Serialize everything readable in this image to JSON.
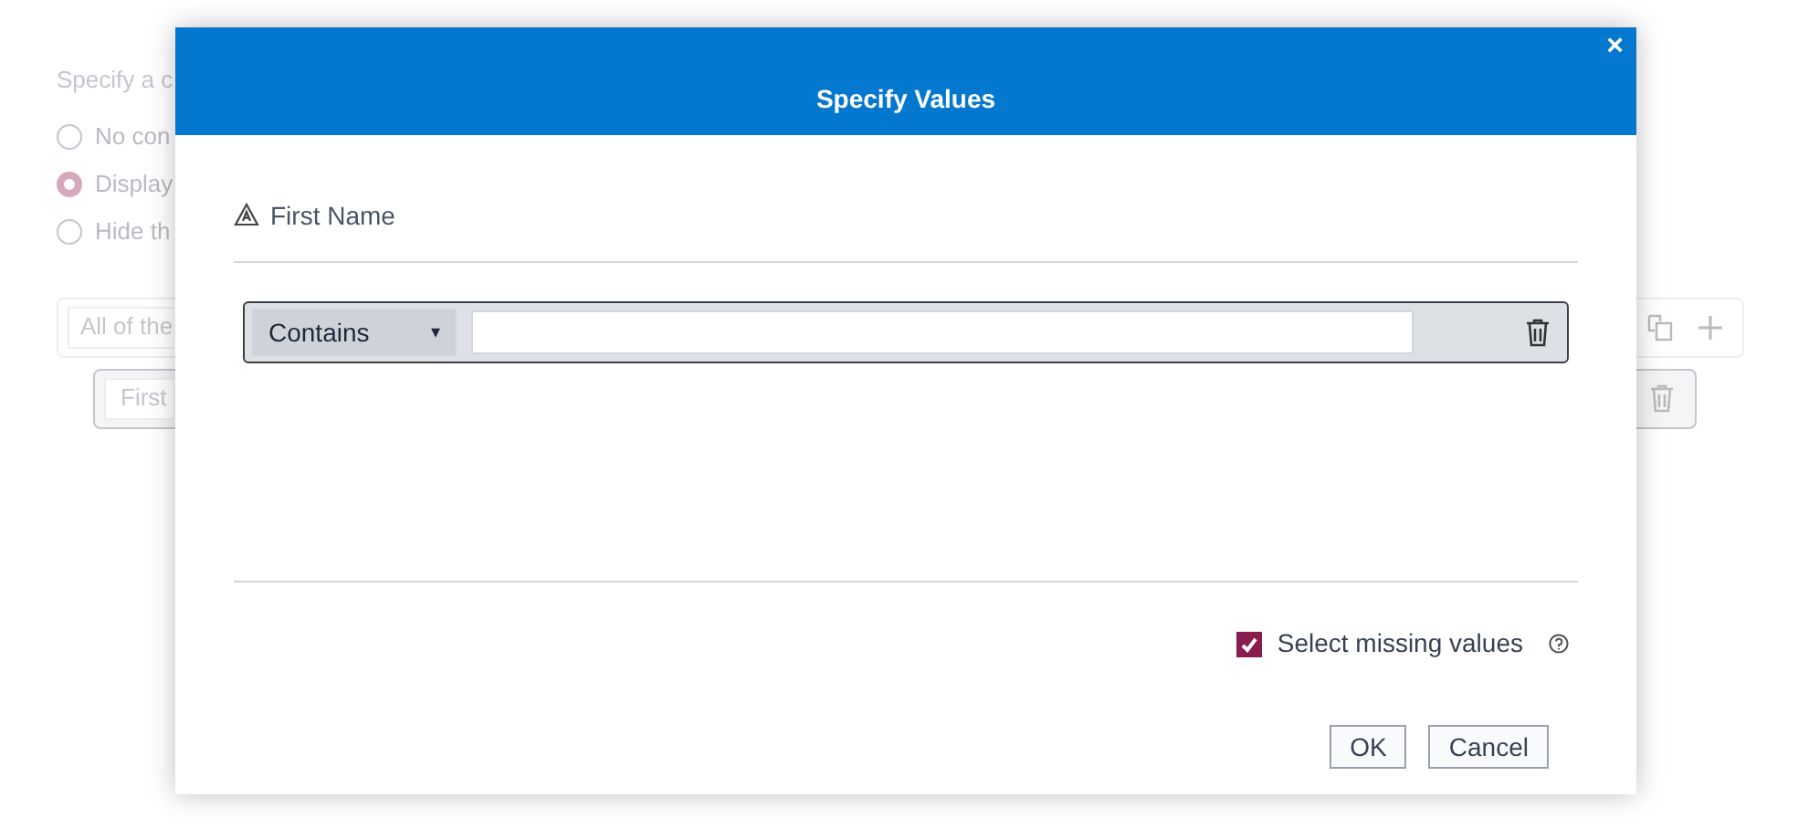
{
  "background": {
    "prompt": "Specify a c",
    "radios": [
      {
        "label": "No con",
        "selected": false
      },
      {
        "label": "Display",
        "selected": true
      },
      {
        "label": "Hide th",
        "selected": false
      }
    ],
    "group_select": "All of the",
    "condition_field": "First"
  },
  "dialog": {
    "title": "Specify Values",
    "close": "×",
    "column": "First Name",
    "operator": "Contains",
    "operator_caret": "▾",
    "missing": {
      "label": "Select missing values",
      "checked": true
    },
    "buttons": [
      "OK",
      "Cancel"
    ]
  }
}
